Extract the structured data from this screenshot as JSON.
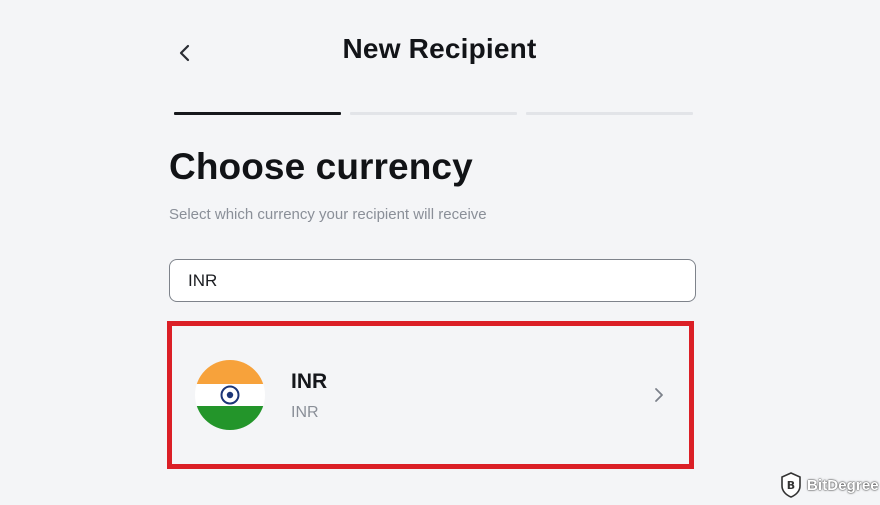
{
  "header": {
    "title": "New Recipient"
  },
  "steps": {
    "total": 3,
    "current": 1
  },
  "section": {
    "title": "Choose currency",
    "subtitle": "Select which currency your recipient will receive"
  },
  "search": {
    "value": "INR"
  },
  "results": [
    {
      "code": "INR",
      "name": "INR",
      "flag": "india-flag"
    }
  ],
  "watermark": {
    "text": "BitDegree"
  },
  "colors": {
    "background": "#f4f5f7",
    "text_primary": "#121418",
    "text_secondary": "#8a8f98",
    "step_active": "#16181c",
    "step_inactive": "#e2e4e8",
    "highlight": "#db1f26",
    "flag_saffron": "#f7a23b",
    "flag_green": "#23952a",
    "flag_navy": "#1c3577"
  }
}
